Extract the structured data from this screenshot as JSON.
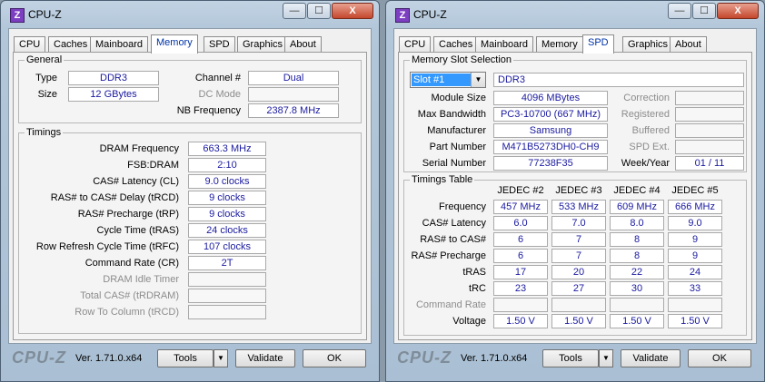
{
  "left_window": {
    "title": "CPU-Z",
    "tabs": [
      {
        "label": "CPU",
        "active": false
      },
      {
        "label": "Caches",
        "active": false
      },
      {
        "label": "Mainboard",
        "active": false
      },
      {
        "label": "Memory",
        "active": true
      },
      {
        "label": "SPD",
        "active": false
      },
      {
        "label": "Graphics",
        "active": false
      },
      {
        "label": "About",
        "active": false
      }
    ],
    "general": {
      "title": "General",
      "type_label": "Type",
      "type_value": "DDR3",
      "size_label": "Size",
      "size_value": "12 GBytes",
      "channel_label": "Channel #",
      "channel_value": "Dual",
      "dc_mode_label": "DC Mode",
      "dc_mode_value": "",
      "nb_freq_label": "NB Frequency",
      "nb_freq_value": "2387.8 MHz"
    },
    "timings": {
      "title": "Timings",
      "rows": [
        {
          "label": "DRAM Frequency",
          "value": "663.3 MHz",
          "disabled": false
        },
        {
          "label": "FSB:DRAM",
          "value": "2:10",
          "disabled": false
        },
        {
          "label": "CAS# Latency (CL)",
          "value": "9.0 clocks",
          "disabled": false
        },
        {
          "label": "RAS# to CAS# Delay (tRCD)",
          "value": "9 clocks",
          "disabled": false
        },
        {
          "label": "RAS# Precharge (tRP)",
          "value": "9 clocks",
          "disabled": false
        },
        {
          "label": "Cycle Time (tRAS)",
          "value": "24 clocks",
          "disabled": false
        },
        {
          "label": "Row Refresh Cycle Time (tRFC)",
          "value": "107 clocks",
          "disabled": false
        },
        {
          "label": "Command Rate (CR)",
          "value": "2T",
          "disabled": false
        },
        {
          "label": "DRAM Idle Timer",
          "value": "",
          "disabled": true
        },
        {
          "label": "Total CAS# (tRDRAM)",
          "value": "",
          "disabled": true
        },
        {
          "label": "Row To Column (tRCD)",
          "value": "",
          "disabled": true
        }
      ]
    }
  },
  "right_window": {
    "title": "CPU-Z",
    "tabs": [
      {
        "label": "CPU",
        "active": false
      },
      {
        "label": "Caches",
        "active": false
      },
      {
        "label": "Mainboard",
        "active": false
      },
      {
        "label": "Memory",
        "active": false
      },
      {
        "label": "SPD",
        "active": true
      },
      {
        "label": "Graphics",
        "active": false
      },
      {
        "label": "About",
        "active": false
      }
    ],
    "slot_selection": {
      "title": "Memory Slot Selection",
      "slot_value": "Slot #1",
      "type_value": "DDR3",
      "fields": [
        {
          "label": "Module Size",
          "value": "4096 MBytes",
          "side_label": "Correction",
          "side_value": ""
        },
        {
          "label": "Max Bandwidth",
          "value": "PC3-10700 (667 MHz)",
          "side_label": "Registered",
          "side_value": ""
        },
        {
          "label": "Manufacturer",
          "value": "Samsung",
          "side_label": "Buffered",
          "side_value": ""
        },
        {
          "label": "Part Number",
          "value": "M471B5273DH0-CH9",
          "side_label": "SPD Ext.",
          "side_value": ""
        },
        {
          "label": "Serial Number",
          "value": "77238F35",
          "side_label": "Week/Year",
          "side_value": "01 / 11"
        }
      ]
    },
    "timings_table": {
      "title": "Timings Table",
      "columns": [
        "JEDEC #2",
        "JEDEC #3",
        "JEDEC #4",
        "JEDEC #5"
      ],
      "rows": [
        {
          "label": "Frequency",
          "values": [
            "457 MHz",
            "533 MHz",
            "609 MHz",
            "666 MHz"
          ],
          "disabled": false
        },
        {
          "label": "CAS# Latency",
          "values": [
            "6.0",
            "7.0",
            "8.0",
            "9.0"
          ],
          "disabled": false
        },
        {
          "label": "RAS# to CAS#",
          "values": [
            "6",
            "7",
            "8",
            "9"
          ],
          "disabled": false
        },
        {
          "label": "RAS# Precharge",
          "values": [
            "6",
            "7",
            "8",
            "9"
          ],
          "disabled": false
        },
        {
          "label": "tRAS",
          "values": [
            "17",
            "20",
            "22",
            "24"
          ],
          "disabled": false
        },
        {
          "label": "tRC",
          "values": [
            "23",
            "27",
            "30",
            "33"
          ],
          "disabled": false
        },
        {
          "label": "Command Rate",
          "values": [
            "",
            "",
            "",
            ""
          ],
          "disabled": true
        },
        {
          "label": "Voltage",
          "values": [
            "1.50 V",
            "1.50 V",
            "1.50 V",
            "1.50 V"
          ],
          "disabled": false
        }
      ]
    }
  },
  "footer": {
    "brand": "CPU-Z",
    "version": "Ver. 1.71.0.x64",
    "tools_label": "Tools",
    "validate_label": "Validate",
    "ok_label": "OK"
  },
  "titlebar_buttons": {
    "minimize": "—",
    "maximize": "☐",
    "close": "X"
  }
}
